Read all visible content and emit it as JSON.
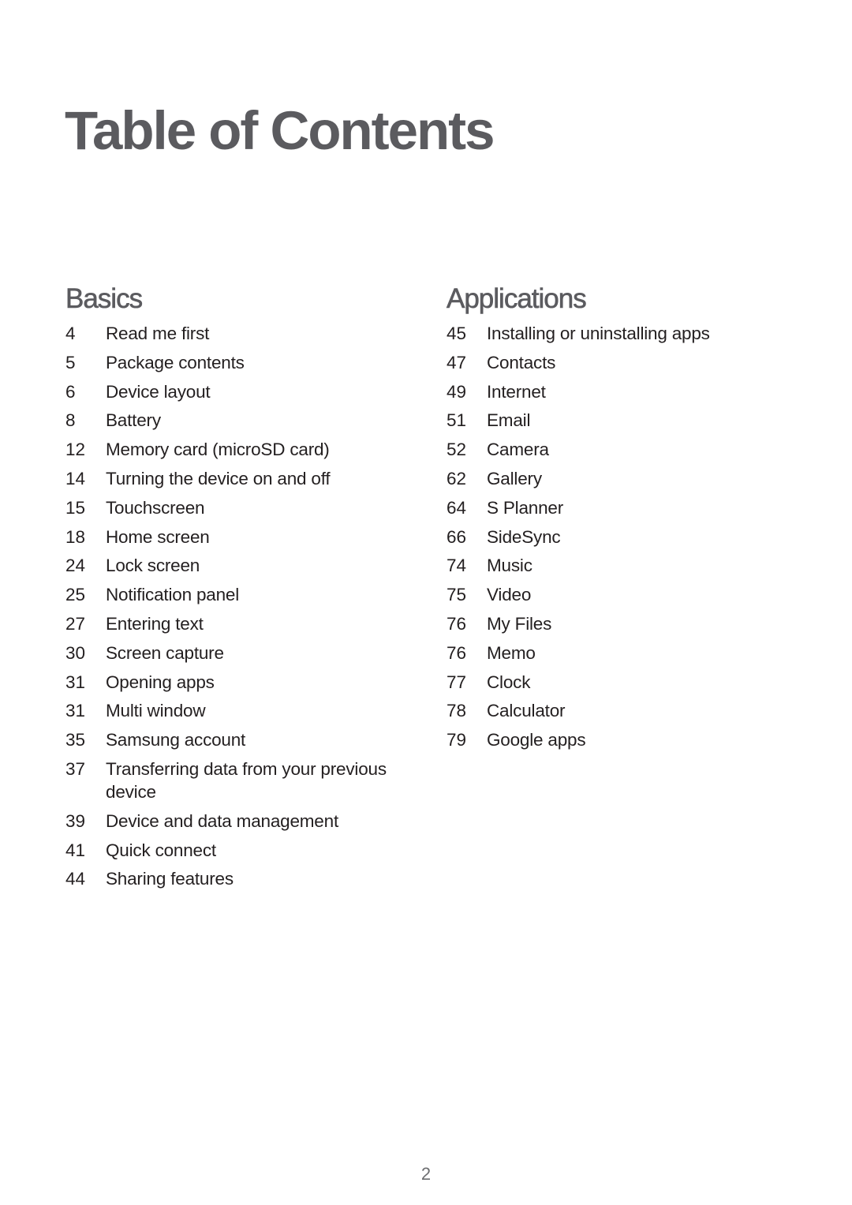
{
  "title": "Table of Contents",
  "sections": [
    {
      "heading": "Basics",
      "items": [
        {
          "page": "4",
          "label": "Read me first"
        },
        {
          "page": "5",
          "label": "Package contents"
        },
        {
          "page": "6",
          "label": "Device layout"
        },
        {
          "page": "8",
          "label": "Battery"
        },
        {
          "page": "12",
          "label": "Memory card (microSD card)"
        },
        {
          "page": "14",
          "label": "Turning the device on and off"
        },
        {
          "page": "15",
          "label": "Touchscreen"
        },
        {
          "page": "18",
          "label": "Home screen"
        },
        {
          "page": "24",
          "label": "Lock screen"
        },
        {
          "page": "25",
          "label": "Notification panel"
        },
        {
          "page": "27",
          "label": "Entering text"
        },
        {
          "page": "30",
          "label": "Screen capture"
        },
        {
          "page": "31",
          "label": "Opening apps"
        },
        {
          "page": "31",
          "label": "Multi window"
        },
        {
          "page": "35",
          "label": "Samsung account"
        },
        {
          "page": "37",
          "label": "Transferring data from your previous device"
        },
        {
          "page": "39",
          "label": "Device and data management"
        },
        {
          "page": "41",
          "label": "Quick connect"
        },
        {
          "page": "44",
          "label": "Sharing features"
        }
      ]
    },
    {
      "heading": "Applications",
      "items": [
        {
          "page": "45",
          "label": "Installing or uninstalling apps"
        },
        {
          "page": "47",
          "label": "Contacts"
        },
        {
          "page": "49",
          "label": "Internet"
        },
        {
          "page": "51",
          "label": "Email"
        },
        {
          "page": "52",
          "label": "Camera"
        },
        {
          "page": "62",
          "label": "Gallery"
        },
        {
          "page": "64",
          "label": "S Planner"
        },
        {
          "page": "66",
          "label": "SideSync"
        },
        {
          "page": "74",
          "label": "Music"
        },
        {
          "page": "75",
          "label": "Video"
        },
        {
          "page": "76",
          "label": "My Files"
        },
        {
          "page": "76",
          "label": "Memo"
        },
        {
          "page": "77",
          "label": "Clock"
        },
        {
          "page": "78",
          "label": "Calculator"
        },
        {
          "page": "79",
          "label": "Google apps"
        }
      ]
    }
  ],
  "footer": {
    "page_number": "2"
  },
  "colors": {
    "heading": "#5b5b5f",
    "body_text": "#231f20",
    "page_number": "#6d6e71"
  }
}
